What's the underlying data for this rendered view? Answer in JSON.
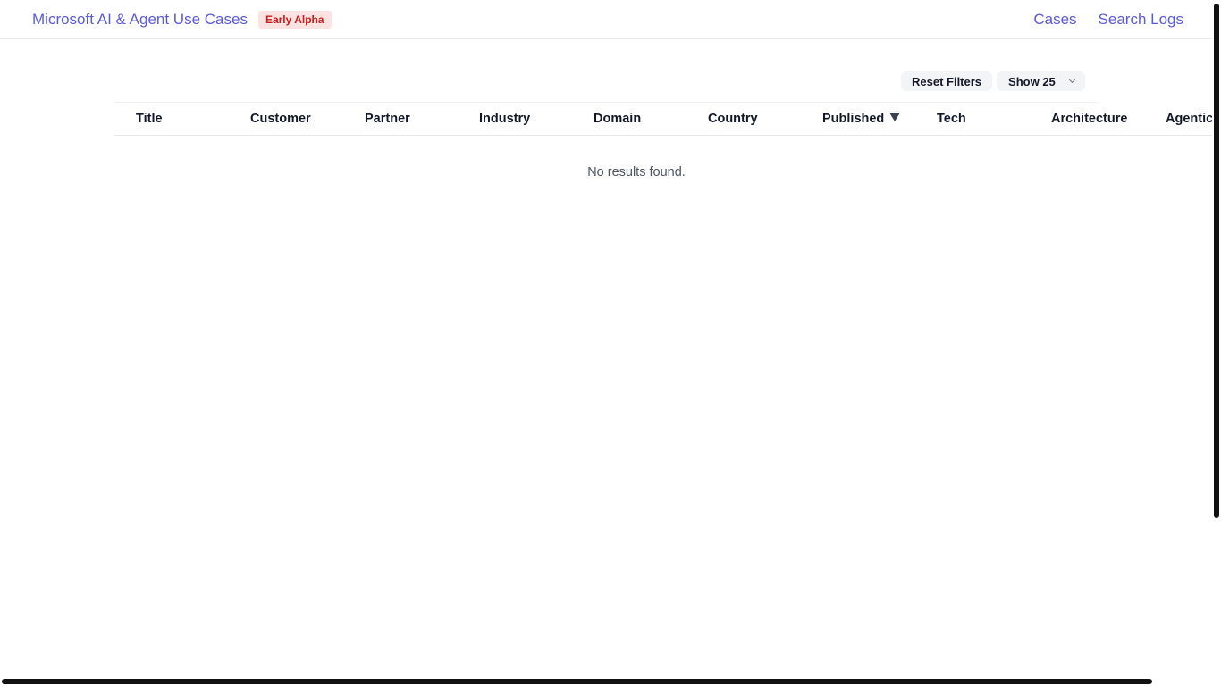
{
  "header": {
    "title": "Microsoft AI & Agent Use Cases",
    "badge": "Early Alpha",
    "nav": [
      "Cases",
      "Search Logs"
    ]
  },
  "controls": {
    "reset_label": "Reset Filters",
    "show_label": "Show 25"
  },
  "table": {
    "columns": [
      "Title",
      "Customer",
      "Partner",
      "Industry",
      "Domain",
      "Country",
      "Published",
      "Tech",
      "Architecture",
      "Agentic"
    ],
    "sorted_column": "Published",
    "sort_direction": "descending",
    "empty_message": "No results found."
  },
  "colors": {
    "accent": "#5b5bd6",
    "badge_text": "#c81e1e",
    "badge_bg": "#fde2e2"
  }
}
